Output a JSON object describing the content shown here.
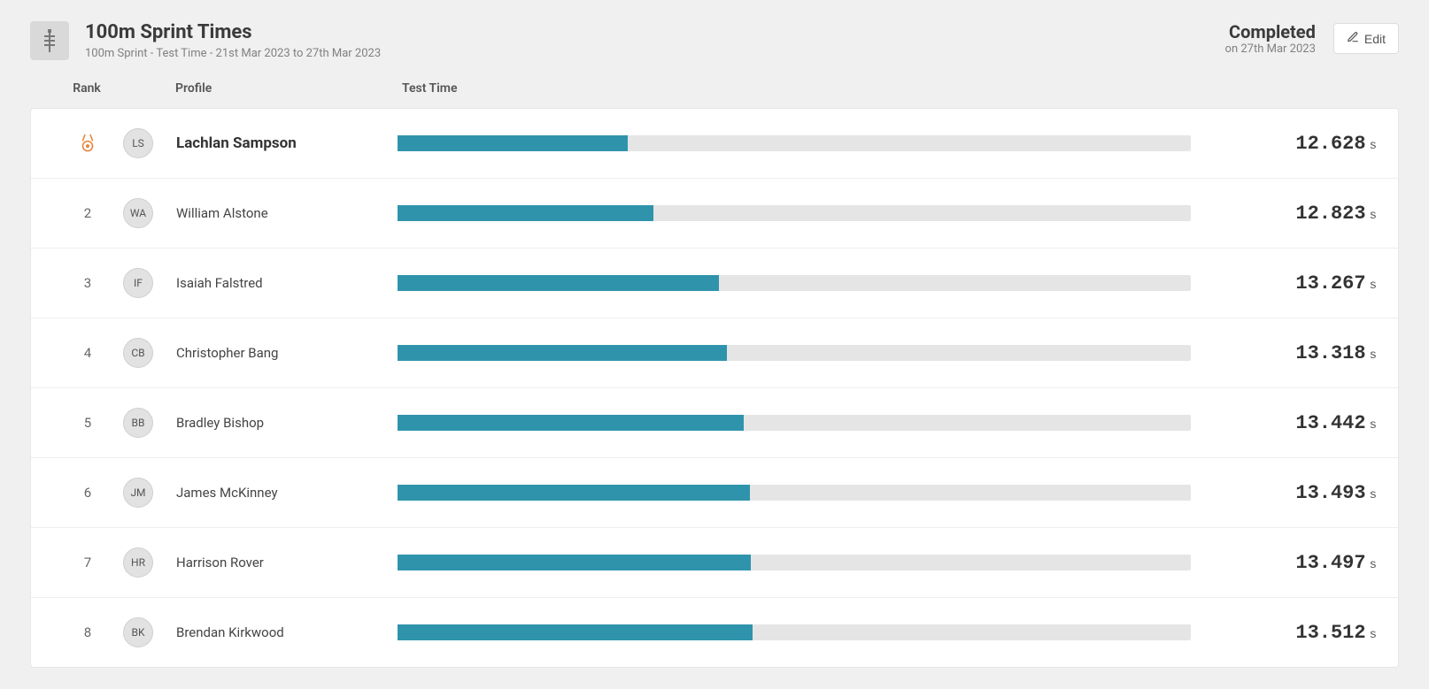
{
  "header": {
    "title": "100m Sprint Times",
    "subtitle": "100m Sprint - Test Time - 21st Mar 2023 to 27th Mar 2023",
    "status_label": "Completed",
    "status_date": "on 27th Mar 2023",
    "edit_label": "Edit"
  },
  "columns": {
    "rank": "Rank",
    "profile": "Profile",
    "testtime": "Test Time"
  },
  "unit": "s",
  "chart_data": {
    "type": "bar",
    "title": "100m Sprint Times",
    "ylabel": "Test Time (s)",
    "categories": [
      "Lachlan Sampson",
      "William Alstone",
      "Isaiah Falstred",
      "Christopher Bang",
      "Bradley Bishop",
      "James McKinney",
      "Harrison Rover",
      "Brendan Kirkwood"
    ],
    "values": [
      12.628,
      12.823,
      13.267,
      13.318,
      13.442,
      13.493,
      13.497,
      13.512
    ],
    "bar_percent": [
      29,
      32.2,
      40.5,
      41.5,
      43.6,
      44.4,
      44.5,
      44.8
    ]
  },
  "rows": [
    {
      "rank": "1",
      "initials": "LS",
      "name": "Lachlan Sampson",
      "value": "12.628",
      "bar": 29.0,
      "first": true
    },
    {
      "rank": "2",
      "initials": "WA",
      "name": "William Alstone",
      "value": "12.823",
      "bar": 32.2
    },
    {
      "rank": "3",
      "initials": "IF",
      "name": "Isaiah Falstred",
      "value": "13.267",
      "bar": 40.5
    },
    {
      "rank": "4",
      "initials": "CB",
      "name": "Christopher Bang",
      "value": "13.318",
      "bar": 41.5
    },
    {
      "rank": "5",
      "initials": "BB",
      "name": "Bradley Bishop",
      "value": "13.442",
      "bar": 43.6
    },
    {
      "rank": "6",
      "initials": "JM",
      "name": "James McKinney",
      "value": "13.493",
      "bar": 44.4
    },
    {
      "rank": "7",
      "initials": "HR",
      "name": "Harrison Rover",
      "value": "13.497",
      "bar": 44.5
    },
    {
      "rank": "8",
      "initials": "BK",
      "name": "Brendan Kirkwood",
      "value": "13.512",
      "bar": 44.8
    }
  ]
}
